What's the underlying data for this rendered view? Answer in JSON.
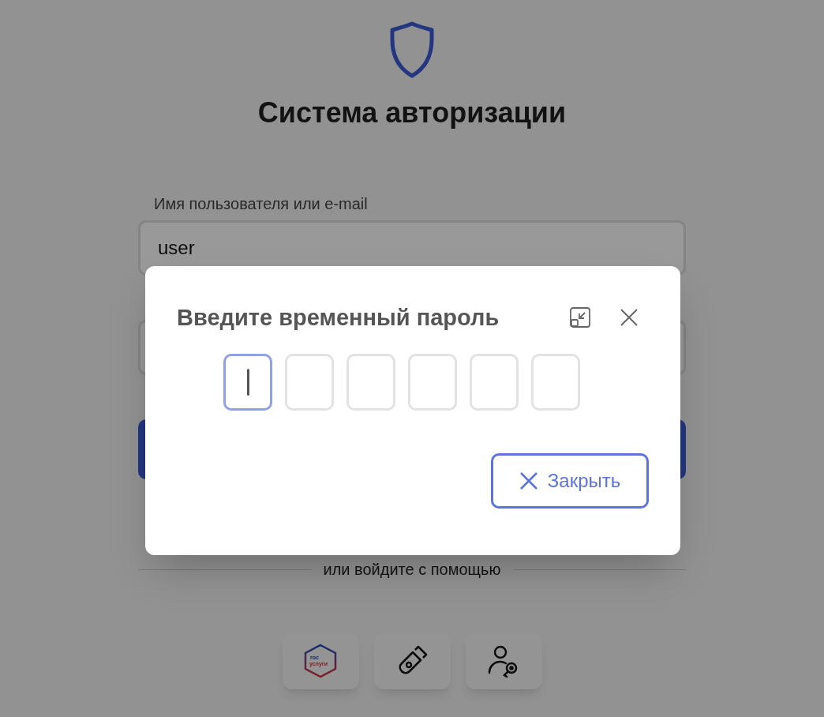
{
  "page": {
    "title": "Система авторизации",
    "username": {
      "label": "Имя пользователя или e-mail",
      "value": "user"
    },
    "divider_text": "или войдите с помощью",
    "login_options": [
      {
        "kind": "gosuslugi",
        "logo_lines": [
          "гос",
          "услуги"
        ]
      },
      {
        "kind": "usb_token"
      },
      {
        "kind": "user_key"
      }
    ]
  },
  "dialog": {
    "title": "Введите временный пароль",
    "code_cells": [
      {
        "selected": true
      },
      {
        "selected": false
      },
      {
        "selected": false
      },
      {
        "selected": false
      },
      {
        "selected": false
      },
      {
        "selected": false
      }
    ],
    "close_button": "Закрыть"
  }
}
